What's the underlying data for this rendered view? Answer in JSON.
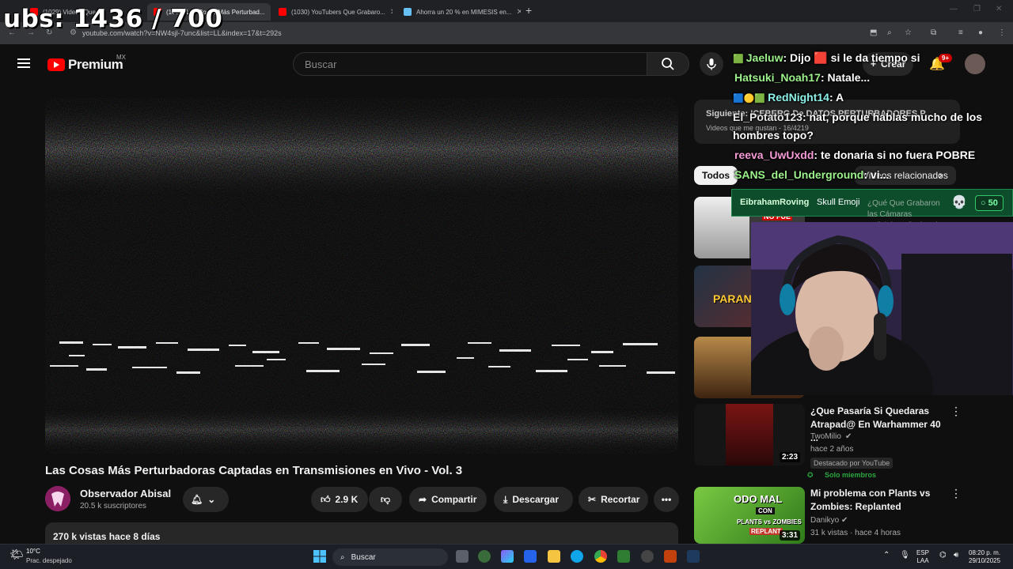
{
  "overlay_counter": "ubs: 1436 / 700",
  "browser": {
    "tabs": [
      {
        "label": "(1029) Videos Que ...",
        "active": false
      },
      {
        "label": "(1029) Las Cosas Más Perturbad...",
        "active": true
      },
      {
        "label": "(1030) YouTubers Que Grabaro...",
        "active": false
      },
      {
        "label": "Ahorra un 20 % en MIMESIS en...",
        "active": false
      }
    ],
    "url": "youtube.com/watch?v=NW4sjl-7unc&list=LL&index=17&t=292s"
  },
  "header": {
    "logo_text": "Premium",
    "region": "MX",
    "search_placeholder": "Buscar",
    "create_label": "Crear",
    "notifications": "9+"
  },
  "video": {
    "title": "Las Cosas Más Perturbadoras Captadas en Transmisiones en Vivo - Vol. 3",
    "channel": "Observador Abisal",
    "subscribers": "20.5 k suscriptores",
    "likes": "2.9 K",
    "share": "Compartir",
    "download": "Descargar",
    "clip": "Recortar",
    "views_date": "270 k vistas  hace 8 días"
  },
  "playlist": {
    "title": "Siguiente: ICEBERG De DATOS PERTURBADORES P...",
    "subtitle": "Videos que me gustan - 16/4219"
  },
  "chips": [
    "Todos",
    "Videos relacionados"
  ],
  "recommendations": [
    {
      "title": "¿Que Pasaría Si Quedaras Atrapad@ En Warhammer 40 ...",
      "channel": "TwoMilio",
      "meta": "hace 2 años",
      "badge": "Destacado por YouTube",
      "members": "Solo miembros",
      "duration": "2:23"
    },
    {
      "title": "Mi problema con Plants vs Zombies: Replanted",
      "channel": "Danikyo",
      "meta": "31 k vistas · hace 4 horas",
      "duration": "3:31"
    }
  ],
  "thumb_texts": {
    "fue": "NO FUE",
    "parano": "PARANO",
    "pvz_top": "ODO MAL",
    "pvz_mid": "CON",
    "pvz_bottom": "PLANTS vs ZOMBIES",
    "pvz_tag": "REPLANT"
  },
  "chat": [
    {
      "user": "Jaeluw",
      "text": ": Dijo 🟥 si le da tiempo si",
      "color": "green"
    },
    {
      "user": "Hatsuki_Noah17",
      "text": ": Natale...",
      "color": "green"
    },
    {
      "user": "RedNight14",
      "text": ": A",
      "color": "green"
    },
    {
      "user": "El_Potato123",
      "text": ": nat, porque hablas mucho de los",
      "color": "white"
    },
    {
      "user": "",
      "text": "hombres topo?",
      "color": "white"
    },
    {
      "user": "reeva_UwUxdd",
      "text": ": te donaria si no fuera POBRE",
      "color": "pink"
    },
    {
      "user": "SANS_del_Underground",
      "text": ": vi...",
      "color": "green"
    }
  ],
  "alert": {
    "user": "EibrahamRoving",
    "message": "Skull Emoji",
    "behind": "¿Qué Que Grabaron las Cámaras Policiales? (iceberg) ...",
    "points": "50"
  },
  "taskbar": {
    "temp": "10°C",
    "weather": "Prac. despejado",
    "search": "Buscar",
    "lang": "ESP",
    "lang2": "LAA",
    "time": "08:20 p. m.",
    "date": "29/10/2025"
  },
  "colors": {
    "yt_red": "#ff0000",
    "bg": "#0f0f0f",
    "chat_green": "#9df28c",
    "alert_green": "#0e4d2c"
  }
}
